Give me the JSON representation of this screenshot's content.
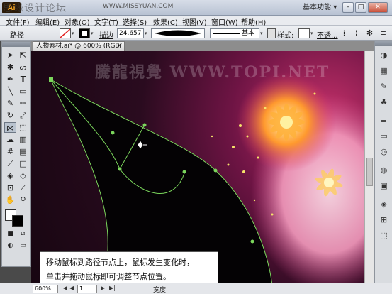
{
  "title_bar": {
    "watermark": "思缘设计论坛",
    "ai_logo": "Ai",
    "url": "WWW.MISSYUAN.COM",
    "workspace": "基本功能",
    "window_buttons": [
      "–",
      "□",
      "✕"
    ]
  },
  "menu": {
    "items": [
      "文件(F)",
      "编辑(E)",
      "对象(O)",
      "文字(T)",
      "选择(S)",
      "效果(C)",
      "视图(V)",
      "窗口(W)",
      "帮助(H)"
    ]
  },
  "control_bar": {
    "mode_label": "路径",
    "stroke_label": "描边",
    "stroke_value": "24.657",
    "basic_label": "基本",
    "style_label": "样式:",
    "opacity_label": "不透...",
    "colors": {
      "fill": "#ffffff",
      "stroke": "#000000",
      "link": "#1b55c7"
    }
  },
  "document": {
    "tab_title": "人物素材.ai* @ 600% (RGB/预览)",
    "canvas_watermark": "騰龍視覺 WWW.TOPI.NET"
  },
  "callout": {
    "line1": "移动鼠标到路径节点上，鼠标发生变化时，",
    "line2": "单击并拖动鼠标即可调整节点位置。"
  },
  "status_bar": {
    "zoom": "600%",
    "page": "1",
    "status": "宽度",
    "nav_first": "|◀",
    "nav_prev": "◀",
    "nav_next": "▶",
    "nav_last": "▶|"
  },
  "tools": [
    "selection-tool",
    "direct-selection-tool",
    "magic-wand-tool",
    "lasso-tool",
    "pen-tool",
    "type-tool",
    "line-tool",
    "rectangle-tool",
    "paintbrush-tool",
    "pencil-tool",
    "rotate-tool",
    "scale-tool",
    "width-tool",
    "free-transform-tool",
    "symbol-sprayer-tool",
    "column-graph-tool",
    "mesh-tool",
    "gradient-tool",
    "eyedropper-tool",
    "blend-tool",
    "live-paint-tool",
    "live-paint-selection-tool",
    "artboard-tool",
    "slice-tool",
    "hand-tool",
    "zoom-tool"
  ],
  "right_panel_icons": [
    "color-panel-icon",
    "swatches-icon",
    "brushes-icon",
    "symbols-icon",
    "stroke-icon",
    "gradient-icon",
    "transparency-icon",
    "appearance-icon",
    "graphic-styles-icon",
    "layers-icon",
    "align-icon",
    "transform-icon"
  ]
}
